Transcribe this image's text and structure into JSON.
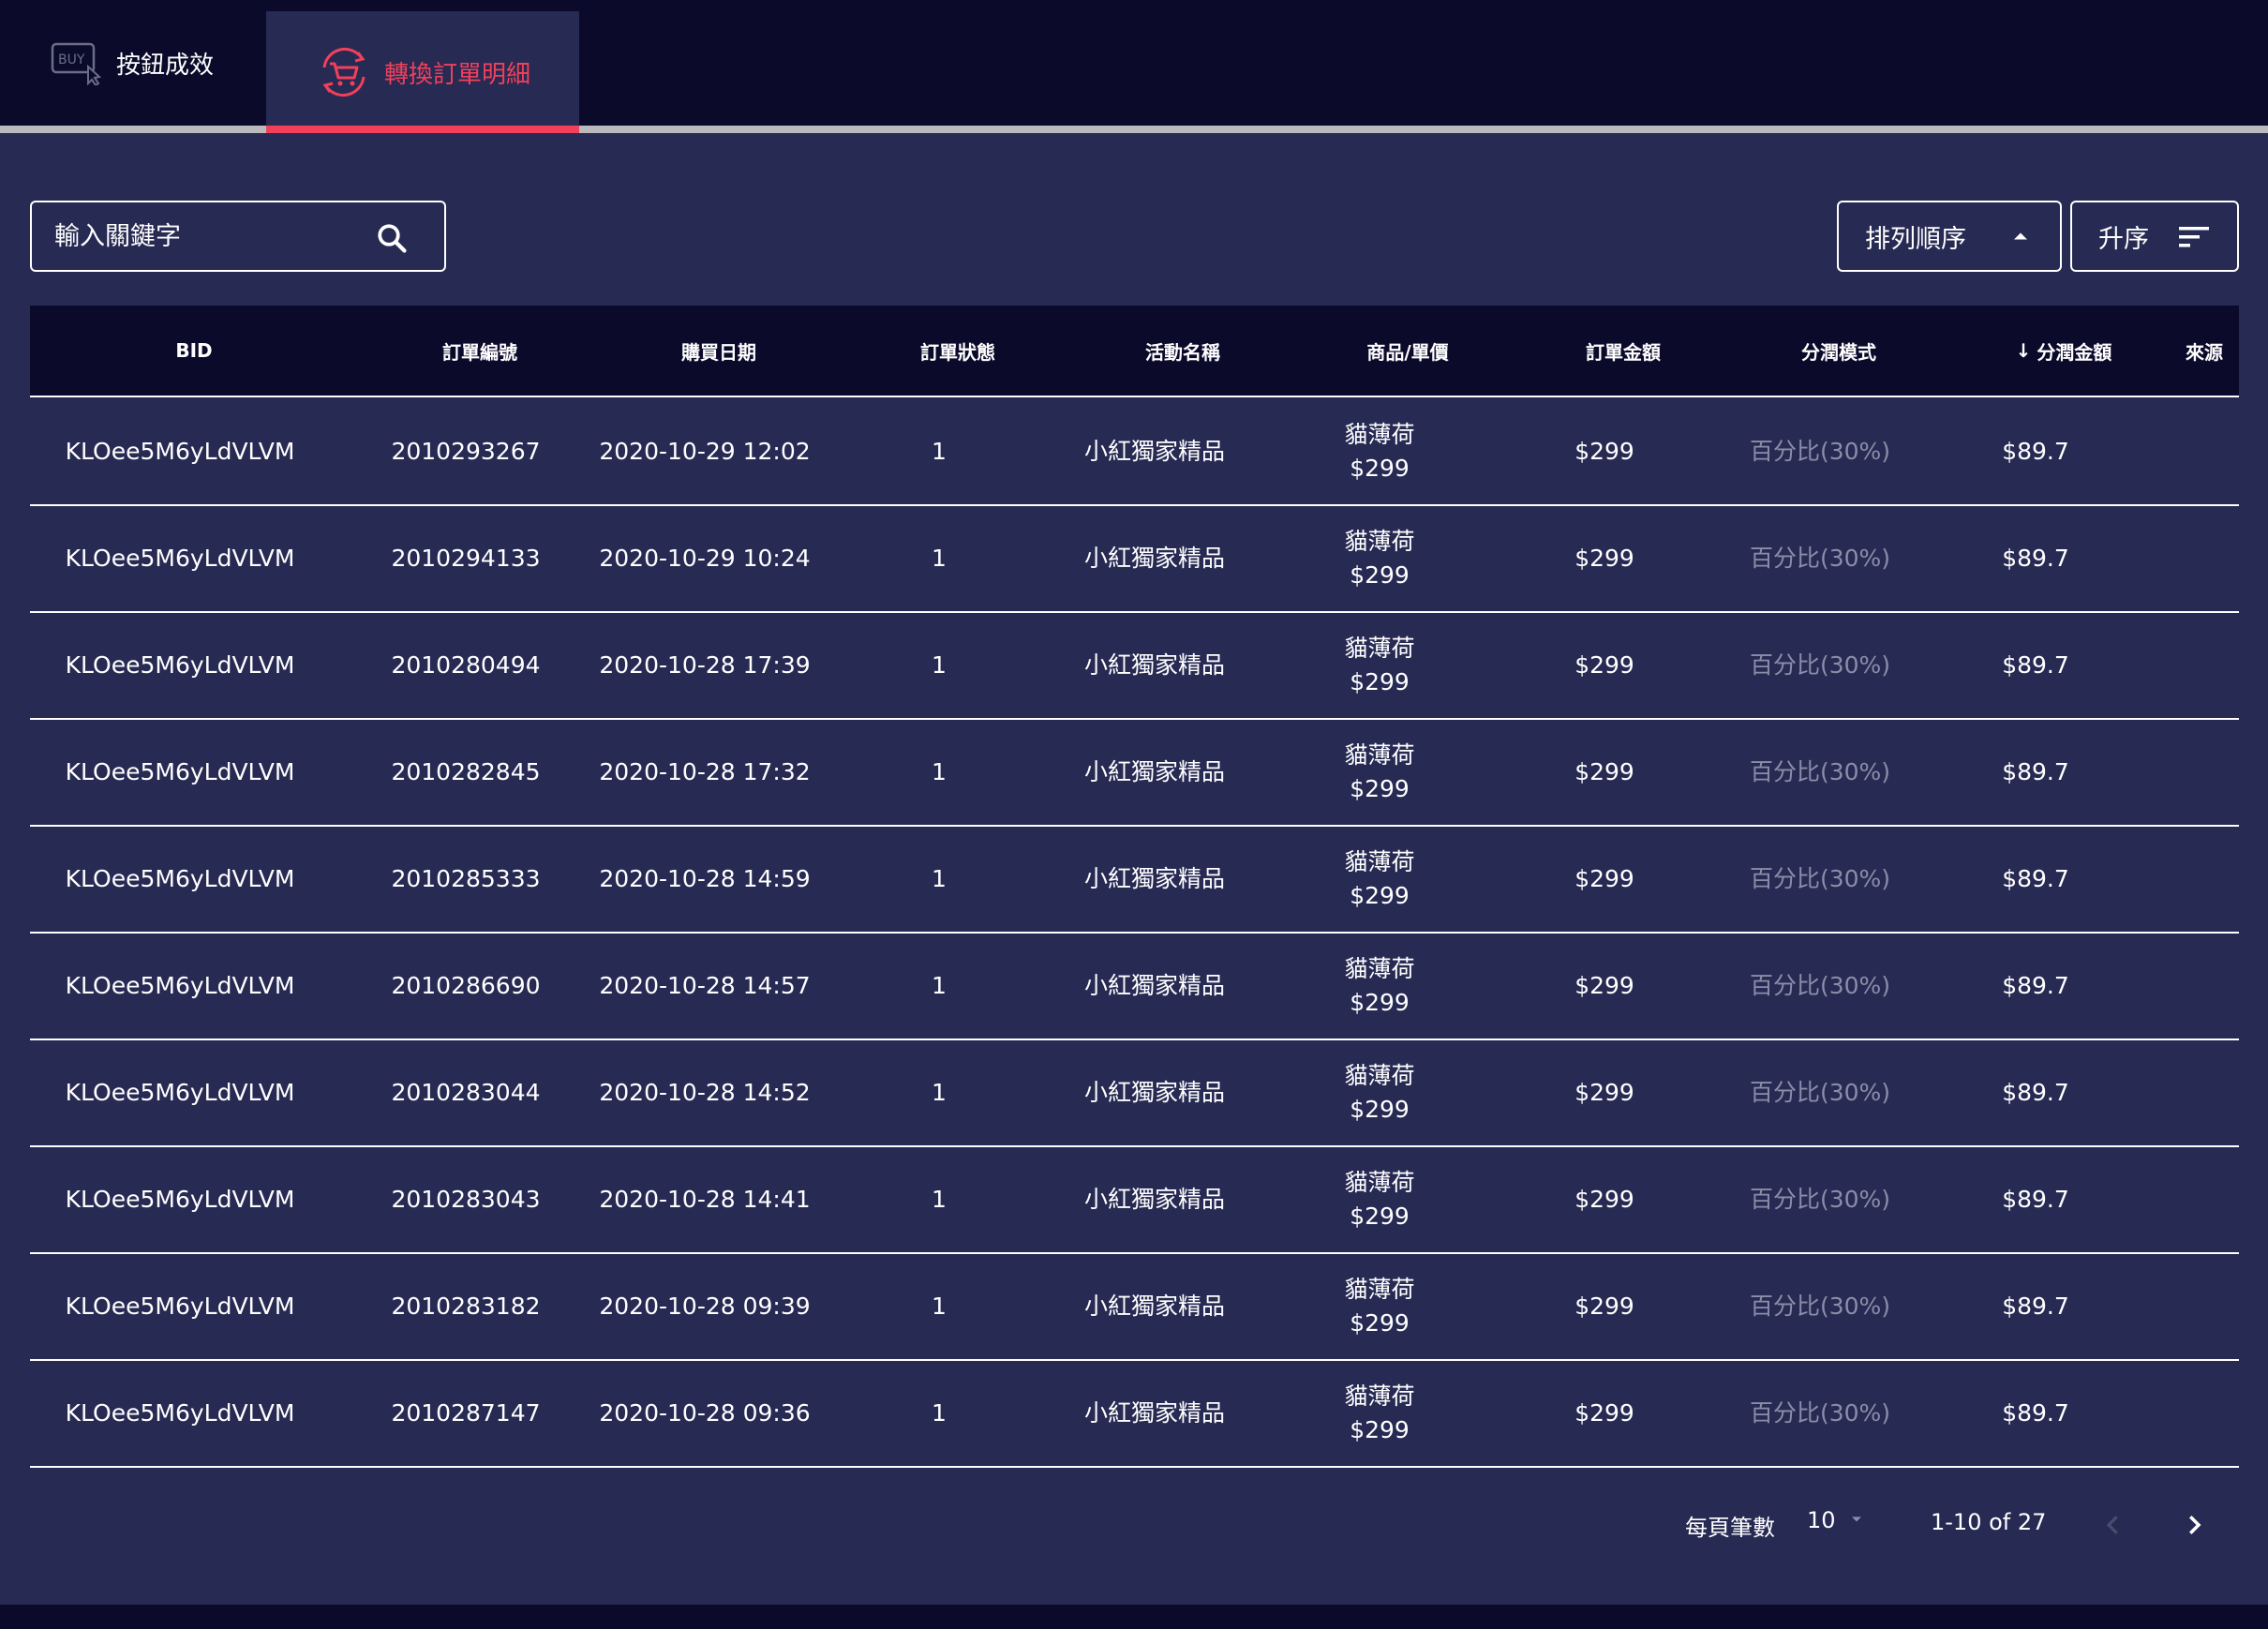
{
  "tabs": [
    {
      "label": "按鈕成效",
      "icon": "buy-cursor-icon",
      "active": false
    },
    {
      "label": "轉換訂單明細",
      "icon": "shopping-cart-icon",
      "active": true
    }
  ],
  "toolbar": {
    "search_placeholder": "輸入關鍵字",
    "sort_order_label": "排列順序",
    "sort_direction_label": "升序"
  },
  "table": {
    "headers": [
      "BID",
      "訂單編號",
      "購買日期",
      "訂單狀態",
      "活動名稱",
      "商品/單價",
      "訂單金額",
      "分潤模式",
      "分潤金額",
      "來源"
    ],
    "sorted_column_arrow": "↓",
    "rows": [
      {
        "bid": "KLOee5M6yLdVLVM",
        "order_no": "2010293267",
        "date": "2020-10-29 12:02",
        "status": "1",
        "campaign": "小紅獨家精品",
        "product": "貓薄荷",
        "unit_price": "$299",
        "amount": "$299",
        "mode": "百分比(30%)",
        "share": "$89.7",
        "source": ""
      },
      {
        "bid": "KLOee5M6yLdVLVM",
        "order_no": "2010294133",
        "date": "2020-10-29 10:24",
        "status": "1",
        "campaign": "小紅獨家精品",
        "product": "貓薄荷",
        "unit_price": "$299",
        "amount": "$299",
        "mode": "百分比(30%)",
        "share": "$89.7",
        "source": ""
      },
      {
        "bid": "KLOee5M6yLdVLVM",
        "order_no": "2010280494",
        "date": "2020-10-28 17:39",
        "status": "1",
        "campaign": "小紅獨家精品",
        "product": "貓薄荷",
        "unit_price": "$299",
        "amount": "$299",
        "mode": "百分比(30%)",
        "share": "$89.7",
        "source": ""
      },
      {
        "bid": "KLOee5M6yLdVLVM",
        "order_no": "2010282845",
        "date": "2020-10-28 17:32",
        "status": "1",
        "campaign": "小紅獨家精品",
        "product": "貓薄荷",
        "unit_price": "$299",
        "amount": "$299",
        "mode": "百分比(30%)",
        "share": "$89.7",
        "source": ""
      },
      {
        "bid": "KLOee5M6yLdVLVM",
        "order_no": "2010285333",
        "date": "2020-10-28 14:59",
        "status": "1",
        "campaign": "小紅獨家精品",
        "product": "貓薄荷",
        "unit_price": "$299",
        "amount": "$299",
        "mode": "百分比(30%)",
        "share": "$89.7",
        "source": ""
      },
      {
        "bid": "KLOee5M6yLdVLVM",
        "order_no": "2010286690",
        "date": "2020-10-28 14:57",
        "status": "1",
        "campaign": "小紅獨家精品",
        "product": "貓薄荷",
        "unit_price": "$299",
        "amount": "$299",
        "mode": "百分比(30%)",
        "share": "$89.7",
        "source": ""
      },
      {
        "bid": "KLOee5M6yLdVLVM",
        "order_no": "2010283044",
        "date": "2020-10-28 14:52",
        "status": "1",
        "campaign": "小紅獨家精品",
        "product": "貓薄荷",
        "unit_price": "$299",
        "amount": "$299",
        "mode": "百分比(30%)",
        "share": "$89.7",
        "source": ""
      },
      {
        "bid": "KLOee5M6yLdVLVM",
        "order_no": "2010283043",
        "date": "2020-10-28 14:41",
        "status": "1",
        "campaign": "小紅獨家精品",
        "product": "貓薄荷",
        "unit_price": "$299",
        "amount": "$299",
        "mode": "百分比(30%)",
        "share": "$89.7",
        "source": ""
      },
      {
        "bid": "KLOee5M6yLdVLVM",
        "order_no": "2010283182",
        "date": "2020-10-28 09:39",
        "status": "1",
        "campaign": "小紅獨家精品",
        "product": "貓薄荷",
        "unit_price": "$299",
        "amount": "$299",
        "mode": "百分比(30%)",
        "share": "$89.7",
        "source": ""
      },
      {
        "bid": "KLOee5M6yLdVLVM",
        "order_no": "2010287147",
        "date": "2020-10-28 09:36",
        "status": "1",
        "campaign": "小紅獨家精品",
        "product": "貓薄荷",
        "unit_price": "$299",
        "amount": "$299",
        "mode": "百分比(30%)",
        "share": "$89.7",
        "source": ""
      }
    ]
  },
  "pager": {
    "rows_per_page_label": "每頁筆數",
    "rows_per_page": "10",
    "range": "1-10 of 27"
  },
  "colors": {
    "accent": "#f2405b",
    "bar": "#0c0a2b",
    "background": "#272a53",
    "muted_text": "#8b8da8"
  }
}
